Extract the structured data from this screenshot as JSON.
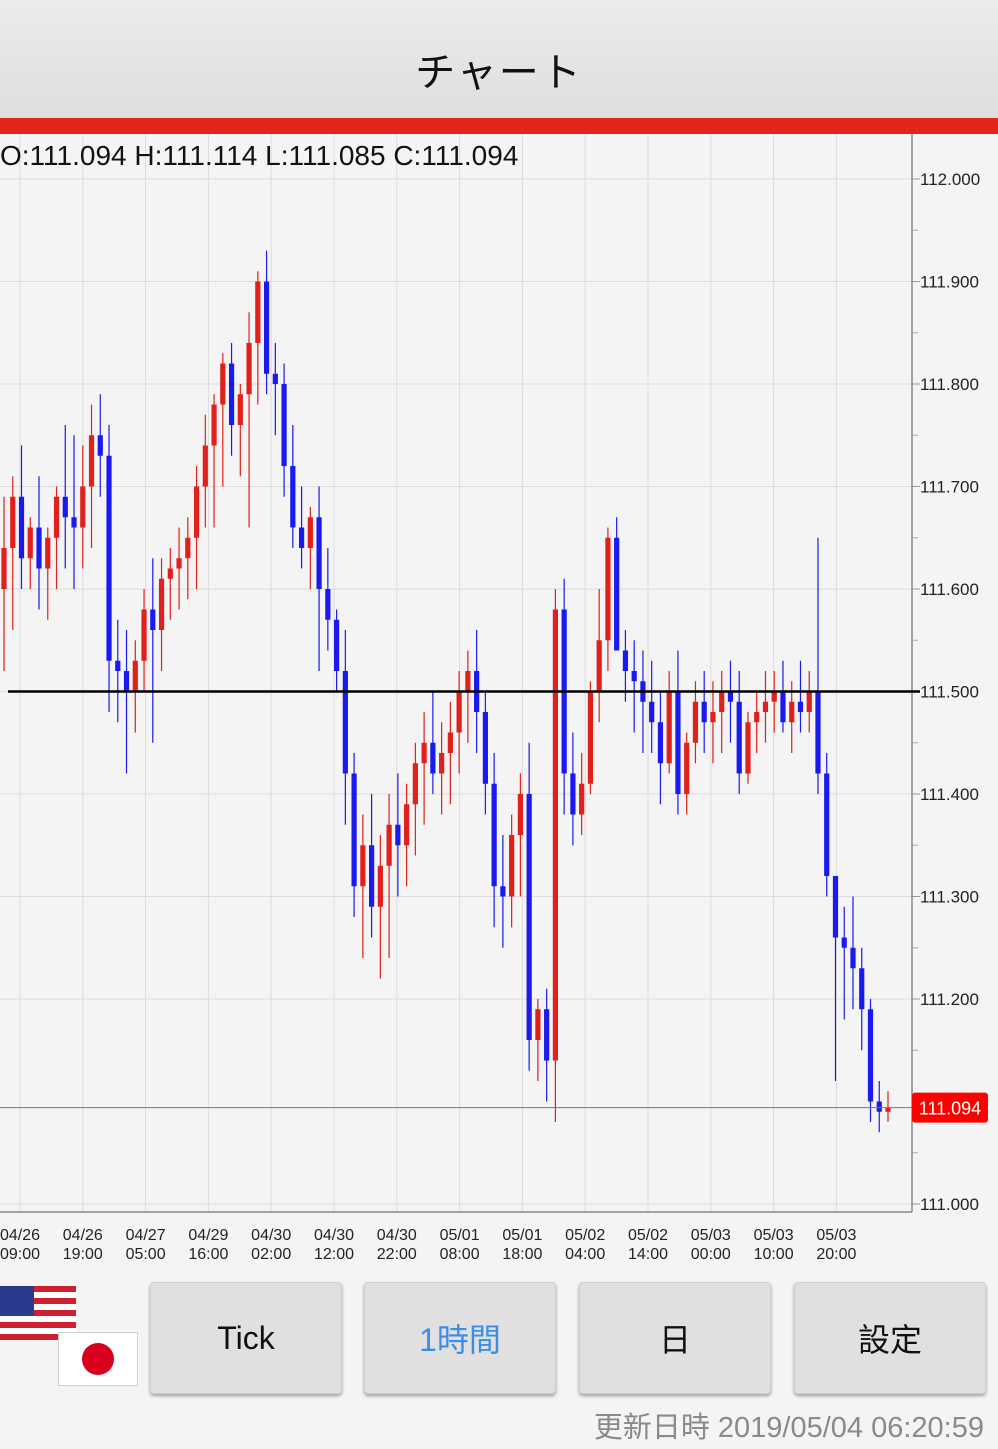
{
  "header": {
    "title": "チャート"
  },
  "ohlc": {
    "text": "O:111.094 H:111.114 L:111.085 C:111.094"
  },
  "colors": {
    "up": "#e0201b",
    "down": "#1a1aee",
    "accent_bar": "#e0261c",
    "active_tab": "#3a8ee6",
    "price_badge": "#ff0000"
  },
  "chart_data": {
    "type": "candlestick",
    "y_axis": {
      "min": 111.0,
      "max": 112.0,
      "ticks": [
        "112.000",
        "111.900",
        "111.800",
        "111.700",
        "111.600",
        "111.500",
        "111.400",
        "111.300",
        "111.200",
        "111.000"
      ]
    },
    "x_tick_labels": [
      [
        "04/26",
        "09:00"
      ],
      [
        "04/26",
        "19:00"
      ],
      [
        "04/27",
        "05:00"
      ],
      [
        "04/29",
        "16:00"
      ],
      [
        "04/30",
        "02:00"
      ],
      [
        "04/30",
        "12:00"
      ],
      [
        "04/30",
        "22:00"
      ],
      [
        "05/01",
        "08:00"
      ],
      [
        "05/01",
        "18:00"
      ],
      [
        "05/02",
        "04:00"
      ],
      [
        "05/02",
        "14:00"
      ],
      [
        "05/03",
        "00:00"
      ],
      [
        "05/03",
        "10:00"
      ],
      [
        "05/03",
        "20:00"
      ]
    ],
    "current_price": "111.094",
    "horizontal_line": 111.5,
    "candles": [
      [
        111.6,
        111.69,
        111.52,
        111.64
      ],
      [
        111.64,
        111.71,
        111.56,
        111.69
      ],
      [
        111.69,
        111.74,
        111.6,
        111.63
      ],
      [
        111.63,
        111.67,
        111.6,
        111.66
      ],
      [
        111.66,
        111.71,
        111.58,
        111.62
      ],
      [
        111.62,
        111.66,
        111.57,
        111.65
      ],
      [
        111.65,
        111.7,
        111.6,
        111.69
      ],
      [
        111.69,
        111.76,
        111.62,
        111.67
      ],
      [
        111.67,
        111.75,
        111.6,
        111.66
      ],
      [
        111.66,
        111.74,
        111.62,
        111.7
      ],
      [
        111.7,
        111.78,
        111.64,
        111.75
      ],
      [
        111.75,
        111.79,
        111.69,
        111.73
      ],
      [
        111.73,
        111.76,
        111.48,
        111.53
      ],
      [
        111.53,
        111.57,
        111.47,
        111.52
      ],
      [
        111.52,
        111.56,
        111.42,
        111.5
      ],
      [
        111.5,
        111.55,
        111.46,
        111.53
      ],
      [
        111.53,
        111.6,
        111.5,
        111.58
      ],
      [
        111.58,
        111.63,
        111.45,
        111.56
      ],
      [
        111.56,
        111.63,
        111.52,
        111.61
      ],
      [
        111.61,
        111.64,
        111.57,
        111.62
      ],
      [
        111.62,
        111.66,
        111.58,
        111.63
      ],
      [
        111.63,
        111.67,
        111.59,
        111.65
      ],
      [
        111.65,
        111.72,
        111.6,
        111.7
      ],
      [
        111.7,
        111.77,
        111.66,
        111.74
      ],
      [
        111.74,
        111.79,
        111.66,
        111.78
      ],
      [
        111.78,
        111.83,
        111.7,
        111.82
      ],
      [
        111.82,
        111.84,
        111.73,
        111.76
      ],
      [
        111.76,
        111.8,
        111.71,
        111.79
      ],
      [
        111.79,
        111.87,
        111.66,
        111.84
      ],
      [
        111.84,
        111.91,
        111.78,
        111.9
      ],
      [
        111.9,
        111.93,
        111.79,
        111.81
      ],
      [
        111.81,
        111.84,
        111.75,
        111.8
      ],
      [
        111.8,
        111.82,
        111.69,
        111.72
      ],
      [
        111.72,
        111.76,
        111.64,
        111.66
      ],
      [
        111.66,
        111.7,
        111.62,
        111.64
      ],
      [
        111.64,
        111.68,
        111.6,
        111.67
      ],
      [
        111.67,
        111.7,
        111.52,
        111.6
      ],
      [
        111.6,
        111.64,
        111.54,
        111.57
      ],
      [
        111.57,
        111.58,
        111.5,
        111.52
      ],
      [
        111.52,
        111.56,
        111.37,
        111.42
      ],
      [
        111.42,
        111.44,
        111.28,
        111.31
      ],
      [
        111.31,
        111.38,
        111.24,
        111.35
      ],
      [
        111.35,
        111.4,
        111.26,
        111.29
      ],
      [
        111.29,
        111.36,
        111.22,
        111.33
      ],
      [
        111.33,
        111.4,
        111.24,
        111.37
      ],
      [
        111.37,
        111.42,
        111.3,
        111.35
      ],
      [
        111.35,
        111.41,
        111.31,
        111.39
      ],
      [
        111.39,
        111.45,
        111.34,
        111.43
      ],
      [
        111.43,
        111.48,
        111.37,
        111.45
      ],
      [
        111.45,
        111.5,
        111.4,
        111.42
      ],
      [
        111.42,
        111.47,
        111.38,
        111.44
      ],
      [
        111.44,
        111.49,
        111.39,
        111.46
      ],
      [
        111.46,
        111.52,
        111.42,
        111.5
      ],
      [
        111.5,
        111.54,
        111.45,
        111.52
      ],
      [
        111.52,
        111.56,
        111.44,
        111.48
      ],
      [
        111.48,
        111.5,
        111.38,
        111.41
      ],
      [
        111.41,
        111.44,
        111.27,
        111.31
      ],
      [
        111.31,
        111.36,
        111.25,
        111.3
      ],
      [
        111.3,
        111.38,
        111.27,
        111.36
      ],
      [
        111.36,
        111.42,
        111.3,
        111.4
      ],
      [
        111.4,
        111.45,
        111.13,
        111.16
      ],
      [
        111.16,
        111.2,
        111.12,
        111.19
      ],
      [
        111.19,
        111.21,
        111.1,
        111.14
      ],
      [
        111.14,
        111.6,
        111.08,
        111.58
      ],
      [
        111.58,
        111.61,
        111.38,
        111.42
      ],
      [
        111.42,
        111.46,
        111.35,
        111.38
      ],
      [
        111.38,
        111.44,
        111.36,
        111.41
      ],
      [
        111.41,
        111.51,
        111.4,
        111.5
      ],
      [
        111.5,
        111.6,
        111.47,
        111.55
      ],
      [
        111.55,
        111.66,
        111.52,
        111.65
      ],
      [
        111.65,
        111.67,
        111.55,
        111.54
      ],
      [
        111.54,
        111.56,
        111.49,
        111.52
      ],
      [
        111.52,
        111.55,
        111.46,
        111.51
      ],
      [
        111.51,
        111.54,
        111.44,
        111.49
      ],
      [
        111.49,
        111.53,
        111.44,
        111.47
      ],
      [
        111.47,
        111.5,
        111.39,
        111.43
      ],
      [
        111.43,
        111.52,
        111.42,
        111.5
      ],
      [
        111.5,
        111.54,
        111.38,
        111.4
      ],
      [
        111.4,
        111.46,
        111.38,
        111.45
      ],
      [
        111.45,
        111.51,
        111.43,
        111.49
      ],
      [
        111.49,
        111.52,
        111.44,
        111.47
      ],
      [
        111.47,
        111.51,
        111.43,
        111.48
      ],
      [
        111.48,
        111.52,
        111.44,
        111.5
      ],
      [
        111.5,
        111.53,
        111.45,
        111.49
      ],
      [
        111.49,
        111.52,
        111.4,
        111.42
      ],
      [
        111.42,
        111.48,
        111.41,
        111.47
      ],
      [
        111.47,
        111.5,
        111.44,
        111.48
      ],
      [
        111.48,
        111.52,
        111.45,
        111.49
      ],
      [
        111.49,
        111.52,
        111.46,
        111.5
      ],
      [
        111.5,
        111.53,
        111.46,
        111.47
      ],
      [
        111.47,
        111.51,
        111.44,
        111.49
      ],
      [
        111.49,
        111.53,
        111.46,
        111.48
      ],
      [
        111.48,
        111.52,
        111.46,
        111.5
      ],
      [
        111.5,
        111.65,
        111.4,
        111.42
      ],
      [
        111.42,
        111.44,
        111.3,
        111.32
      ],
      [
        111.32,
        111.31,
        111.12,
        111.26
      ],
      [
        111.26,
        111.29,
        111.18,
        111.25
      ],
      [
        111.25,
        111.3,
        111.19,
        111.23
      ],
      [
        111.23,
        111.25,
        111.15,
        111.19
      ],
      [
        111.19,
        111.2,
        111.08,
        111.1
      ],
      [
        111.1,
        111.12,
        111.07,
        111.09
      ],
      [
        111.09,
        111.11,
        111.08,
        111.094
      ]
    ]
  },
  "buttons": [
    {
      "label": "Tick",
      "active": false
    },
    {
      "label": "1時間",
      "active": true
    },
    {
      "label": "日",
      "active": false
    },
    {
      "label": "設定",
      "active": false
    }
  ],
  "footer": {
    "updated_label": "更新日時 2019/05/04 06:20:59"
  }
}
